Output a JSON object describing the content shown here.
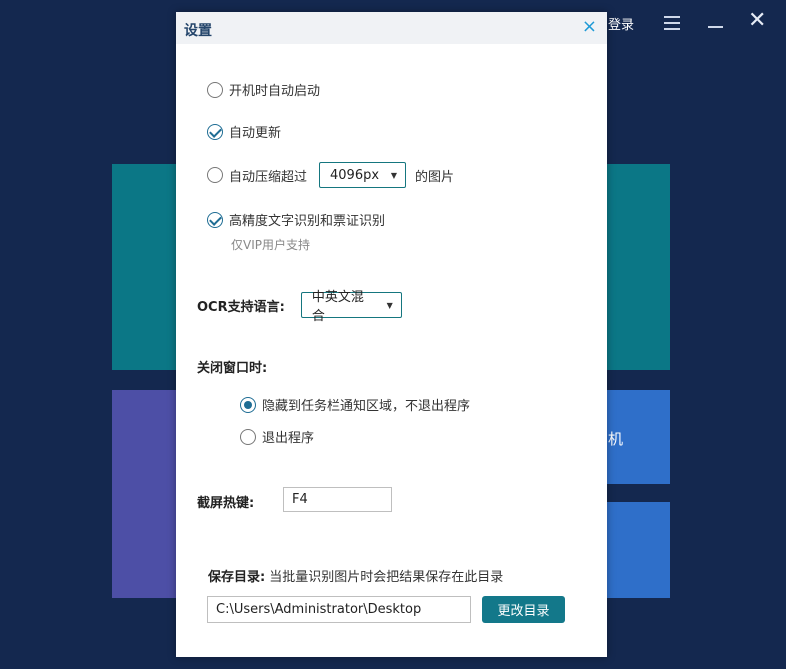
{
  "background": {
    "login_label": "登录",
    "tile_text": "机",
    "menu_icon": "hamburger-icon",
    "minimize_icon": "minimize-icon",
    "close_icon": "close-icon"
  },
  "dialog": {
    "title": "设置",
    "close_glyph": "×",
    "options": {
      "autostart": {
        "label": "开机时自动启动",
        "checked": false
      },
      "autoupdate": {
        "label": "自动更新",
        "checked": true
      },
      "compress": {
        "label": "自动压缩超过",
        "checked": false,
        "select_value": "4096px",
        "suffix": "的图片"
      },
      "hd_ocr": {
        "label": "高精度文字识别和票证识别",
        "checked": true,
        "note": "仅VIP用户支持"
      }
    },
    "ocr_lang": {
      "label": "OCR支持语言:",
      "value": "中英文混合"
    },
    "close_window": {
      "label": "关闭窗口时:",
      "options": [
        {
          "label": "隐藏到任务栏通知区域，不退出程序",
          "selected": true
        },
        {
          "label": "退出程序",
          "selected": false
        }
      ]
    },
    "hotkey": {
      "label": "截屏热键:",
      "value": "F4"
    },
    "save_dir": {
      "label": "保存目录:",
      "description": "当批量识别图片时会把结果保存在此目录",
      "path": "C:\\Users\\Administrator\\Desktop",
      "button": "更改目录"
    }
  },
  "colors": {
    "accent": "#13788a",
    "close_x": "#1e9ad6",
    "background": "#14284f"
  }
}
